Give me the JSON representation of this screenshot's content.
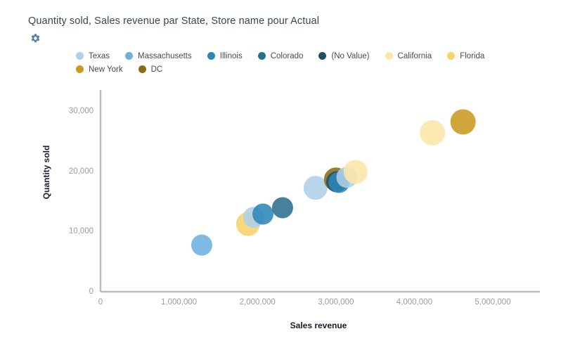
{
  "header": {
    "title": "Quantity sold, Sales revenue par State, Store name pour Actual",
    "settings_icon": "gear-icon"
  },
  "legend": {
    "position": "top",
    "items": [
      {
        "label": "Texas",
        "color": "#aecfe8"
      },
      {
        "label": "Massachusetts",
        "color": "#6cb0de"
      },
      {
        "label": "Illinois",
        "color": "#2e86b8"
      },
      {
        "label": "Colorado",
        "color": "#2b6e8f"
      },
      {
        "label": "(No Value)",
        "color": "#1f4f63"
      },
      {
        "label": "California",
        "color": "#fbe6a8"
      },
      {
        "label": "Florida",
        "color": "#f7d36a"
      },
      {
        "label": "New York",
        "color": "#c9991f"
      },
      {
        "label": "DC",
        "color": "#8a6d12"
      }
    ]
  },
  "chart_data": {
    "type": "scatter",
    "title": "Quantity sold, Sales revenue par State, Store name pour Actual",
    "xlabel": "Sales revenue",
    "ylabel": "Quantity sold",
    "xlim": [
      0,
      5600000
    ],
    "ylim": [
      0,
      33500
    ],
    "xticks": [
      0,
      1000000,
      2000000,
      3000000,
      4000000,
      5000000
    ],
    "xtick_labels": [
      "0",
      "1,000,000",
      "2,000,000",
      "3,000,000",
      "4,000,000",
      "5,000,000"
    ],
    "yticks": [
      0,
      10000,
      20000,
      30000
    ],
    "ytick_labels": [
      "0",
      "10,000",
      "20,000",
      "30,000"
    ],
    "grid": false,
    "legend_position": "top",
    "points": [
      {
        "series": "Massachusetts",
        "x": 1290000,
        "y": 7750,
        "r": 15,
        "color": "#6cb0de"
      },
      {
        "series": "Florida",
        "x": 1880000,
        "y": 11250,
        "r": 17,
        "color": "#f7d36a"
      },
      {
        "series": "Texas",
        "x": 1950000,
        "y": 12350,
        "r": 15,
        "color": "#aecfe8"
      },
      {
        "series": "Illinois",
        "x": 2070000,
        "y": 12900,
        "r": 15,
        "color": "#2e86b8"
      },
      {
        "series": "Colorado",
        "x": 2320000,
        "y": 13950,
        "r": 15,
        "color": "#2b6e8f"
      },
      {
        "series": "Texas",
        "x": 2740000,
        "y": 17250,
        "r": 17,
        "color": "#aecfe8"
      },
      {
        "series": "DC",
        "x": 3000000,
        "y": 18650,
        "r": 17,
        "color": "#8a6d12"
      },
      {
        "series": "(No Value)",
        "x": 3010000,
        "y": 18250,
        "r": 15,
        "color": "#1f4f63"
      },
      {
        "series": "Illinois",
        "x": 3040000,
        "y": 18150,
        "r": 15,
        "color": "#2e86b8"
      },
      {
        "series": "Texas",
        "x": 3140000,
        "y": 19000,
        "r": 15,
        "color": "#aecfe8"
      },
      {
        "series": "California",
        "x": 3250000,
        "y": 19900,
        "r": 17,
        "color": "#fbe6a8"
      },
      {
        "series": "California",
        "x": 4230000,
        "y": 26400,
        "r": 18,
        "color": "#fbe6a8"
      },
      {
        "series": "New York",
        "x": 4620000,
        "y": 28200,
        "r": 18,
        "color": "#c9991f"
      }
    ]
  },
  "axes": {
    "x_title": "Sales revenue",
    "y_title": "Quantity sold"
  }
}
